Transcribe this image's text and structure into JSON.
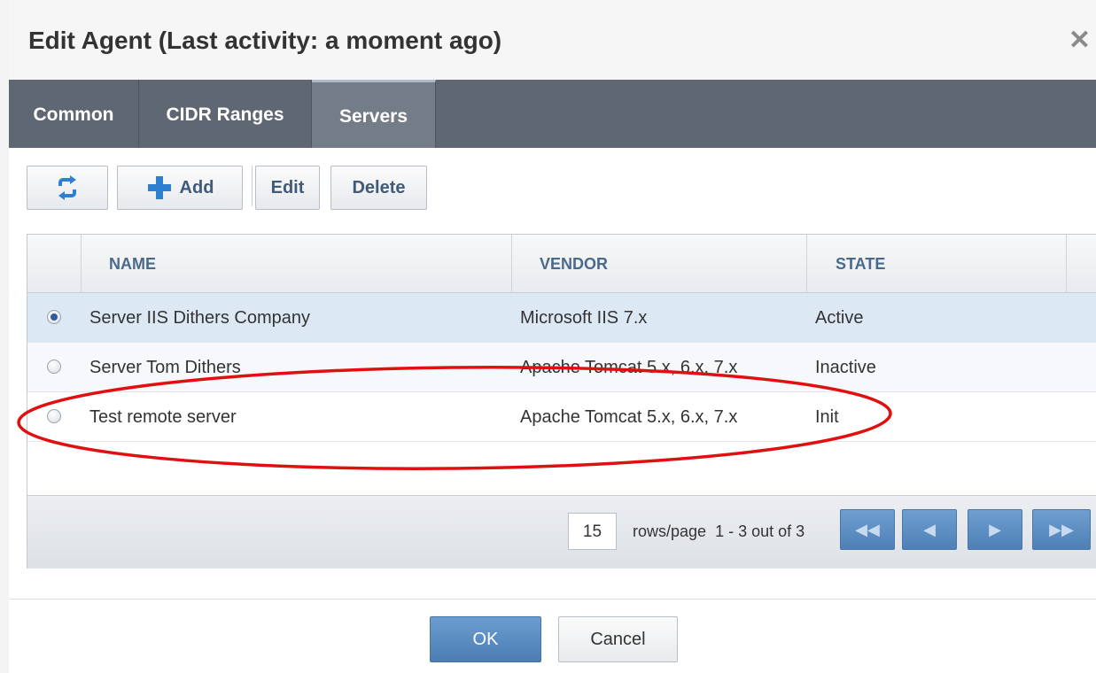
{
  "dialog": {
    "title": "Edit Agent (Last activity: a moment ago)",
    "close_glyph": "✕"
  },
  "tabs": [
    {
      "label": "Common",
      "active": false
    },
    {
      "label": "CIDR Ranges",
      "active": false
    },
    {
      "label": "Servers",
      "active": true
    }
  ],
  "toolbar": {
    "refresh_icon": "refresh-icon",
    "add_label": "Add",
    "add_icon": "plus-icon",
    "edit_label": "Edit",
    "delete_label": "Delete"
  },
  "table": {
    "columns": [
      "NAME",
      "VENDOR",
      "STATE"
    ],
    "rows": [
      {
        "name": "Server IIS Dithers Company",
        "vendor": "Microsoft IIS 7.x",
        "state": "Active",
        "selected": true
      },
      {
        "name": "Server Tom Dithers",
        "vendor": "Apache Tomcat 5.x, 6.x, 7.x",
        "state": "Inactive",
        "selected": false
      },
      {
        "name": "Test remote server",
        "vendor": "Apache Tomcat 5.x, 6.x, 7.x",
        "state": "Init",
        "selected": false
      }
    ]
  },
  "pager": {
    "rows_per_page": "15",
    "rows_label": "rows/page",
    "range_text": "1 - 3 out of 3"
  },
  "footer": {
    "ok_label": "OK",
    "cancel_label": "Cancel"
  },
  "colors": {
    "tab_bar": "#5f6772",
    "accent_blue": "#4f80b5",
    "annotation_red": "#e01010"
  }
}
